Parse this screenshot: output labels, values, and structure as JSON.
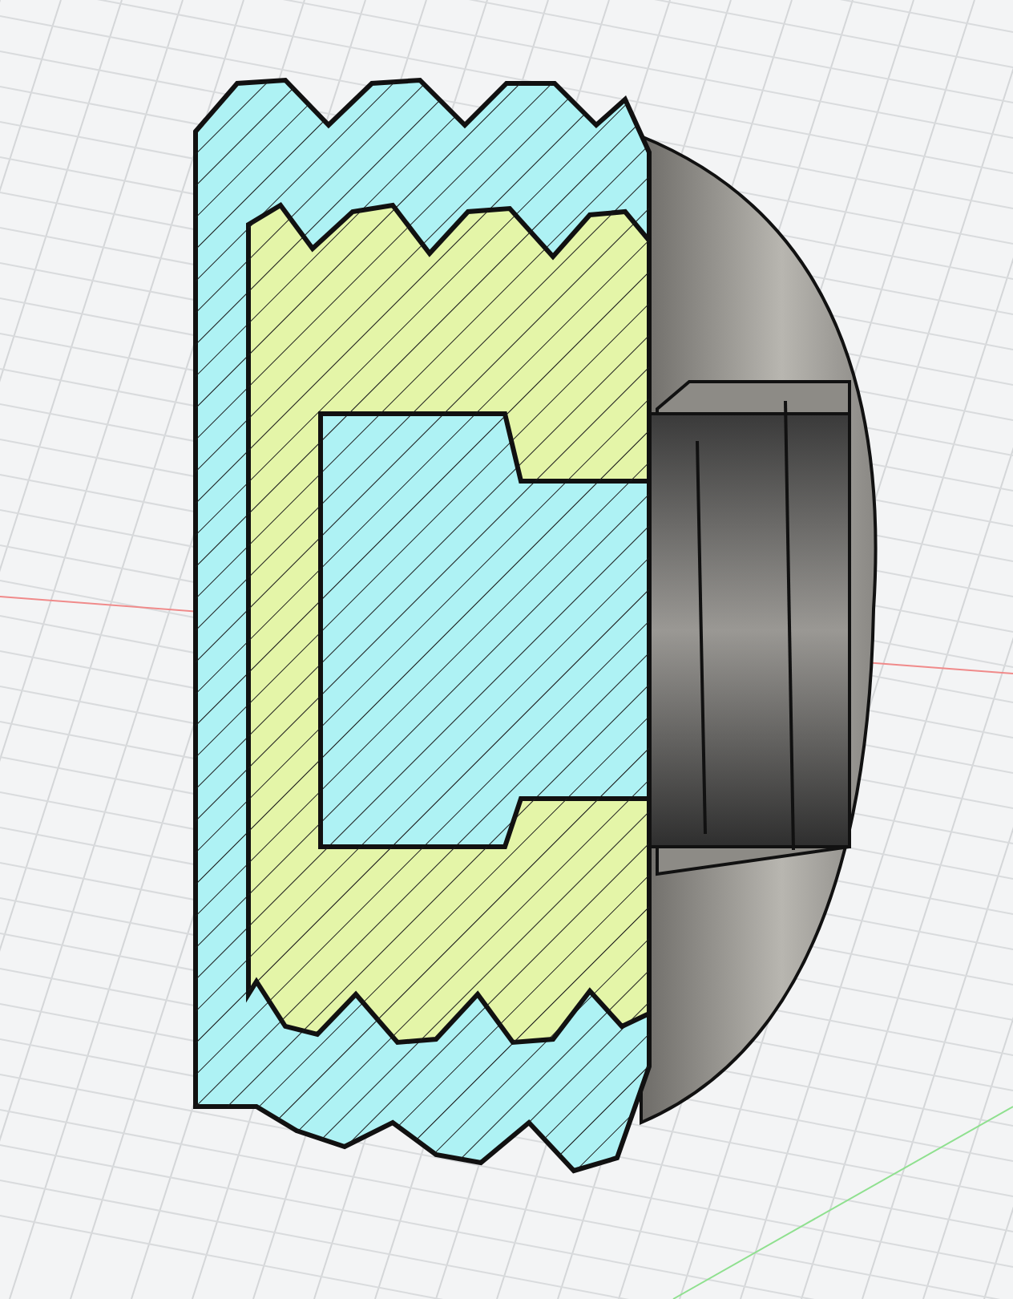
{
  "viewport": {
    "grid": true,
    "section_view": true
  }
}
